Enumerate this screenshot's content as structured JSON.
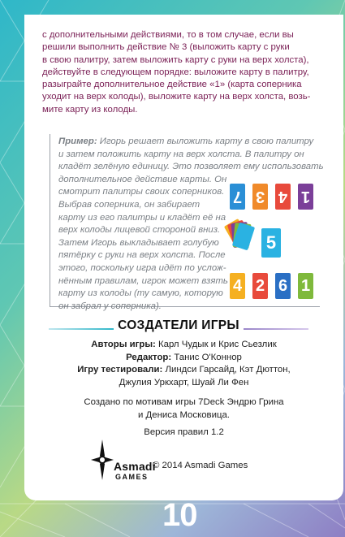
{
  "intro": {
    "lines": [
      "с дополнительными действиями, то в том случае, если вы",
      "решили выполнить действие № 3 (выложить карту с руки",
      "в свою палитру, затем выложить карту с руки на верх холста),",
      "действуйте в следующем порядке: выложите карту в палитру,",
      "разыграйте дополнительное действие «1» (карта соперника",
      "уходит на верх колоды), выложите карту на верх холста, возь-",
      "мите карту из колоды."
    ]
  },
  "example": {
    "label": "Пример:",
    "first_line_rest": " Игорь решает выложить карту в свою палитру",
    "lines": [
      "и затем положить карту на верх холста. В палитру он",
      "кладёт зелёную единицу. Это позволяет ему использовать",
      "дополнительное действие карты. Он",
      "смотрит палитры своих соперников.",
      "Выбрав соперника, он забирает",
      "карту из его палитры и кладёт её на",
      "верх колоды лицевой стороной вниз.",
      "Затем Игорь выкладывает голубую",
      "пятёрку с руки на верх холста. После",
      "этого, поскольку игра идёт по услож-",
      "нённым правилам, игрок может взять",
      "карту из колоды (ту самую, которую",
      "он забрал у соперника)."
    ],
    "opponent_cards": [
      {
        "value": "7",
        "color": "#2a8fd6"
      },
      {
        "value": "3",
        "color": "#f08a2a"
      },
      {
        "value": "4",
        "color": "#e84a3c"
      },
      {
        "value": "1",
        "color": "#7b3f99"
      }
    ],
    "center_card": {
      "value": "5",
      "color": "#2ab2e2"
    },
    "player_cards": [
      {
        "value": "4",
        "color": "#f5b021"
      },
      {
        "value": "2",
        "color": "#e84a3c"
      },
      {
        "value": "6",
        "color": "#2a6fc4"
      },
      {
        "value": "1",
        "color": "#7fb93c"
      }
    ]
  },
  "creators": {
    "title": "СОЗДАТЕЛИ ИГРЫ",
    "authors_label": "Авторы игры:",
    "authors": " Карл Чудык и Крис Сьезлик",
    "editor_label": "Редактор:",
    "editor": " Танис О'Коннор",
    "testers_label": "Игру тестировали:",
    "testers_line1": " Линдси Гарсайд, Кэт Дюттон,",
    "testers_line2": "Джулия Уркхарт, Шуай Ли Фен",
    "based_line1": "Создано по мотивам игры 7Deck Эндрю Грина",
    "based_line2": "и Дениса Московица.",
    "version": "Версия правил 1.2",
    "logo_name": "Asmadi",
    "logo_sub": "GAMES",
    "copyright": "© 2014 Asmadi Games"
  },
  "page_number": "10",
  "colors": {
    "intro_text": "#7a1f55",
    "example_text": "#7b8086",
    "accent": "#2fb7c9"
  }
}
